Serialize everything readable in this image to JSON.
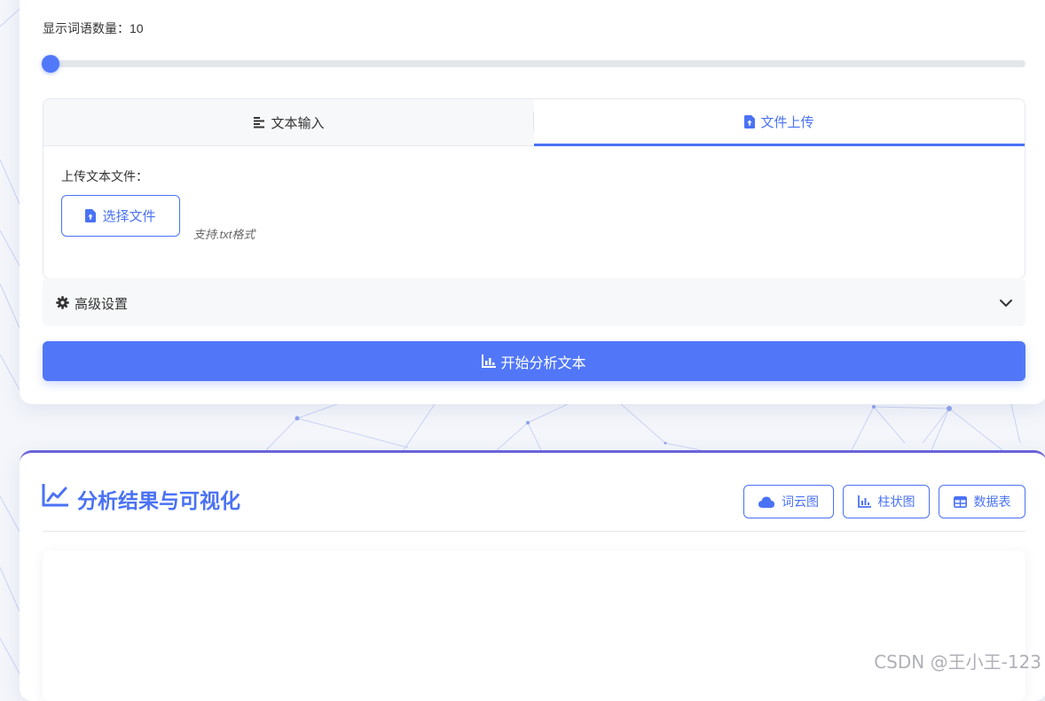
{
  "settings": {
    "word_count_label": "显示词语数量：10",
    "word_count_value": 10
  },
  "tabs": [
    {
      "label": "文本输入",
      "icon": "align-left-icon",
      "active": false
    },
    {
      "label": "文件上传",
      "icon": "file-upload-icon",
      "active": true
    }
  ],
  "upload": {
    "label": "上传文本文件：",
    "button_label": "选择文件",
    "hint": "支持.txt格式"
  },
  "advanced": {
    "label": "高级设置",
    "icon": "gear-icon"
  },
  "analyze_button_label": "开始分析文本",
  "results": {
    "title": "分析结果与可视化",
    "views": [
      {
        "label": "词云图",
        "icon": "cloud-icon"
      },
      {
        "label": "柱状图",
        "icon": "bar-chart-icon"
      },
      {
        "label": "数据表",
        "icon": "table-icon"
      }
    ]
  },
  "watermark": "CSDN @王小王-123",
  "colors": {
    "accent": "#4a72f5",
    "button_primary": "#5177f8",
    "gradient_border": "#6b63d8"
  }
}
